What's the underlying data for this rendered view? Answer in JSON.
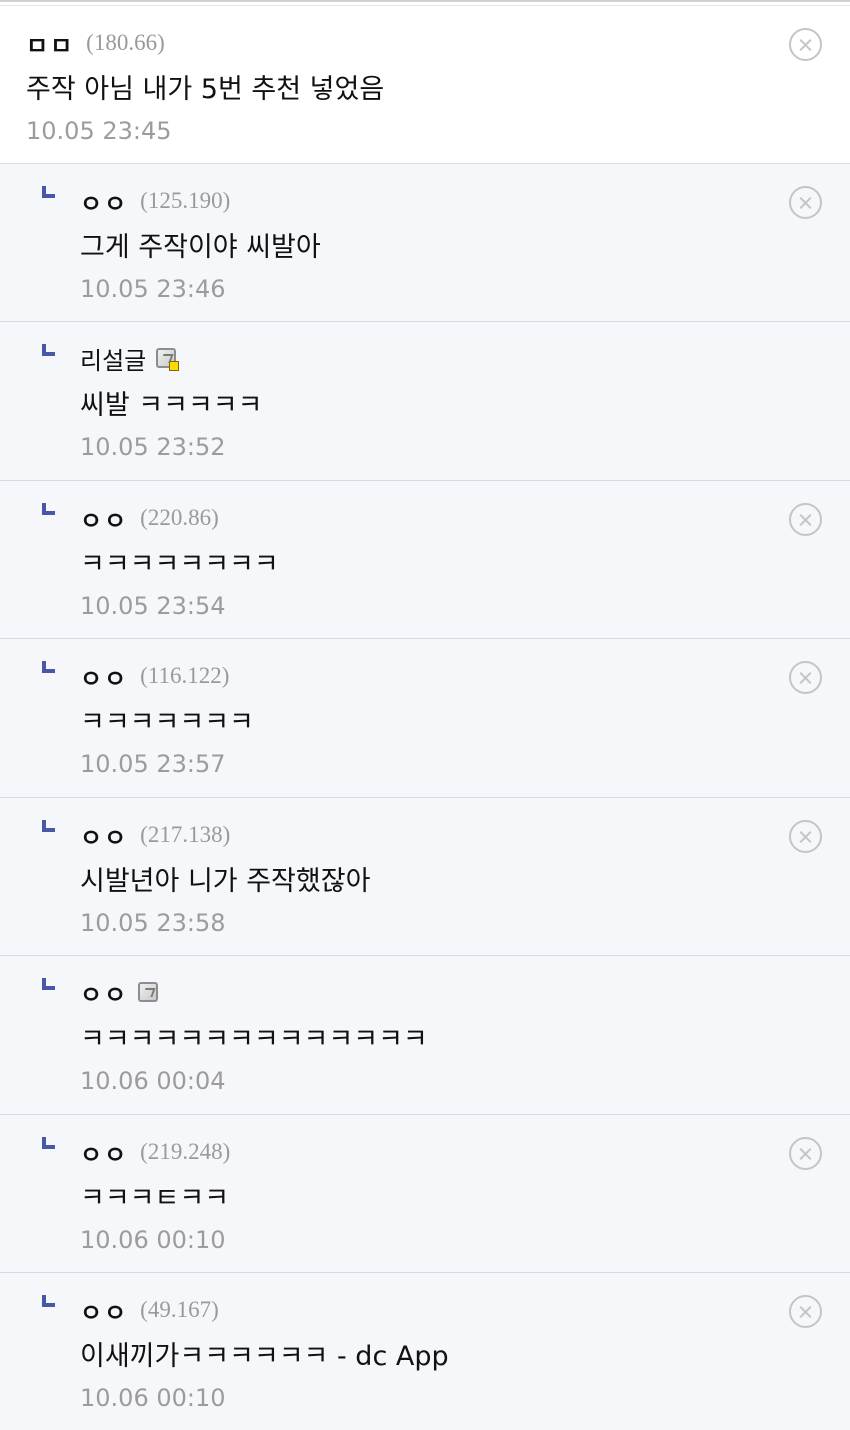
{
  "comments": [
    {
      "nick": "ㅁㅁ",
      "ip": "(180.66)",
      "body": "주작 아님 내가 5번 추천 넣었음",
      "time": "10.05 23:45"
    },
    {
      "nick": "ㅇㅇ",
      "ip": "(125.190)",
      "body": "그게 주작이야 씨발아",
      "time": "10.05 23:46"
    },
    {
      "nick": "리설글",
      "body": "씨발 ㅋㅋㅋㅋㅋ",
      "time": "10.05 23:52",
      "icon": "member-icon"
    },
    {
      "nick": "ㅇㅇ",
      "ip": "(220.86)",
      "body": "ㅋㅋㅋㅋㅋㅋㅋㅋ",
      "time": "10.05 23:54"
    },
    {
      "nick": "ㅇㅇ",
      "ip": "(116.122)",
      "body": "ㅋㅋㅋㅋㅋㅋㅋ",
      "time": "10.05 23:57"
    },
    {
      "nick": "ㅇㅇ",
      "ip": "(217.138)",
      "body": "시발년아 니가 주작했잖아",
      "time": "10.05 23:58"
    },
    {
      "nick": "ㅇㅇ",
      "body": "ㅋㅋㅋㅋㅋㅋㅋㅋㅋㅋㅋㅋㅋㅋ",
      "time": "10.06 00:04",
      "icon": "member-icon"
    },
    {
      "nick": "ㅇㅇ",
      "ip": "(219.248)",
      "body": "ㅋㅋㅋㅌㅋㅋ",
      "time": "10.06 00:10"
    },
    {
      "nick": "ㅇㅇ",
      "ip": "(49.167)",
      "body": "이새끼가ㅋㅋㅋㅋㅋㅋ - dc App",
      "time": "10.06 00:10"
    }
  ],
  "colors": {
    "reply_background": "#f6f7fb",
    "reply_marker": "#4a56a6",
    "member_icon_badge": "#ffd800"
  }
}
